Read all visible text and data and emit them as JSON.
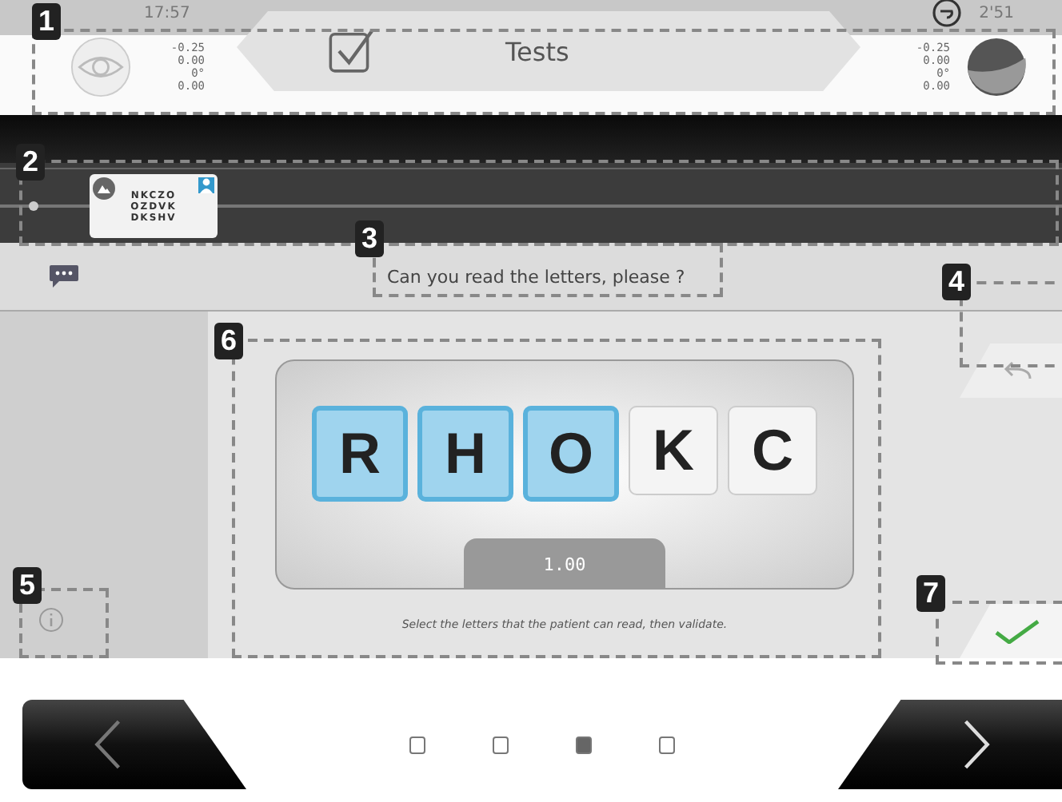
{
  "header": {
    "time": "17:57",
    "timer": "2'51",
    "title": "Tests",
    "left_values": [
      "-0.25",
      "0.00",
      "0°",
      "0.00"
    ],
    "right_values": [
      "-0.25",
      "0.00",
      "0°",
      "0.00"
    ]
  },
  "chart_thumb": {
    "rows": [
      "NKCZO",
      "OZDVK",
      "DKSHV"
    ]
  },
  "question": "Can you read the letters, please ?",
  "letters": [
    {
      "char": "R",
      "selected": true
    },
    {
      "char": "H",
      "selected": true
    },
    {
      "char": "O",
      "selected": true
    },
    {
      "char": "K",
      "selected": false
    },
    {
      "char": "C",
      "selected": false
    }
  ],
  "acuity": "1.00",
  "hint": "Select the letters that the patient can read, then validate.",
  "pages": [
    {
      "selected": false
    },
    {
      "selected": false
    },
    {
      "selected": true
    },
    {
      "selected": false
    }
  ],
  "callouts": [
    "1",
    "2",
    "3",
    "4",
    "5",
    "6",
    "7"
  ]
}
